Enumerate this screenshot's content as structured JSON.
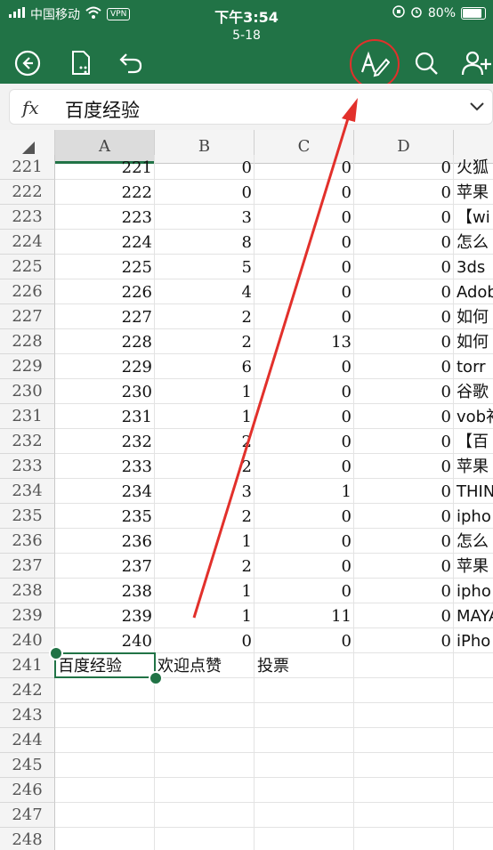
{
  "status_bar": {
    "carrier": "中国移动",
    "vpn": "VPN",
    "time": "下午3:54",
    "battery": "80%",
    "battery_level": 0.8
  },
  "file": {
    "name": "5-18"
  },
  "toolbar": {
    "icons": [
      "back-icon",
      "document-icon",
      "undo-icon",
      "draw-pen-icon",
      "search-icon",
      "add-person-icon"
    ]
  },
  "formula_bar": {
    "fx": "fx",
    "value": "百度经验"
  },
  "columns": [
    "A",
    "B",
    "C",
    "D"
  ],
  "rows": [
    {
      "n": "221",
      "a": "221",
      "b": "0",
      "c": "0",
      "d": "0",
      "e": "火狐"
    },
    {
      "n": "222",
      "a": "222",
      "b": "0",
      "c": "0",
      "d": "0",
      "e": "苹果"
    },
    {
      "n": "223",
      "a": "223",
      "b": "3",
      "c": "0",
      "d": "0",
      "e": "【wi"
    },
    {
      "n": "224",
      "a": "224",
      "b": "8",
      "c": "0",
      "d": "0",
      "e": "怎么"
    },
    {
      "n": "225",
      "a": "225",
      "b": "5",
      "c": "0",
      "d": "0",
      "e": "3ds"
    },
    {
      "n": "226",
      "a": "226",
      "b": "4",
      "c": "0",
      "d": "0",
      "e": "Adob"
    },
    {
      "n": "227",
      "a": "227",
      "b": "2",
      "c": "0",
      "d": "0",
      "e": "如何"
    },
    {
      "n": "228",
      "a": "228",
      "b": "2",
      "c": "13",
      "d": "0",
      "e": "如何"
    },
    {
      "n": "229",
      "a": "229",
      "b": "6",
      "c": "0",
      "d": "0",
      "e": "torr"
    },
    {
      "n": "230",
      "a": "230",
      "b": "1",
      "c": "0",
      "d": "0",
      "e": "谷歌"
    },
    {
      "n": "231",
      "a": "231",
      "b": "1",
      "c": "0",
      "d": "0",
      "e": "vob补"
    },
    {
      "n": "232",
      "a": "232",
      "b": "2",
      "c": "0",
      "d": "0",
      "e": "【百"
    },
    {
      "n": "233",
      "a": "233",
      "b": "2",
      "c": "0",
      "d": "0",
      "e": "苹果"
    },
    {
      "n": "234",
      "a": "234",
      "b": "3",
      "c": "1",
      "d": "0",
      "e": "THIN"
    },
    {
      "n": "235",
      "a": "235",
      "b": "2",
      "c": "0",
      "d": "0",
      "e": "ipho"
    },
    {
      "n": "236",
      "a": "236",
      "b": "1",
      "c": "0",
      "d": "0",
      "e": "怎么"
    },
    {
      "n": "237",
      "a": "237",
      "b": "2",
      "c": "0",
      "d": "0",
      "e": "苹果"
    },
    {
      "n": "238",
      "a": "238",
      "b": "1",
      "c": "0",
      "d": "0",
      "e": "ipho"
    },
    {
      "n": "239",
      "a": "239",
      "b": "1",
      "c": "11",
      "d": "0",
      "e": "MAYA"
    },
    {
      "n": "240",
      "a": "240",
      "b": "0",
      "c": "0",
      "d": "0",
      "e": "iPho"
    },
    {
      "n": "241",
      "a": "百度经验",
      "b": "欢迎点赞",
      "c": "投票",
      "d": "",
      "e": ""
    },
    {
      "n": "242",
      "a": "",
      "b": "",
      "c": "",
      "d": "",
      "e": ""
    },
    {
      "n": "243",
      "a": "",
      "b": "",
      "c": "",
      "d": "",
      "e": ""
    },
    {
      "n": "244",
      "a": "",
      "b": "",
      "c": "",
      "d": "",
      "e": ""
    },
    {
      "n": "245",
      "a": "",
      "b": "",
      "c": "",
      "d": "",
      "e": ""
    },
    {
      "n": "246",
      "a": "",
      "b": "",
      "c": "",
      "d": "",
      "e": ""
    },
    {
      "n": "247",
      "a": "",
      "b": "",
      "c": "",
      "d": "",
      "e": ""
    },
    {
      "n": "248",
      "a": "",
      "b": "",
      "c": "",
      "d": "",
      "e": ""
    }
  ],
  "colors": {
    "accent": "#217346",
    "annotation": "#e2302b"
  }
}
